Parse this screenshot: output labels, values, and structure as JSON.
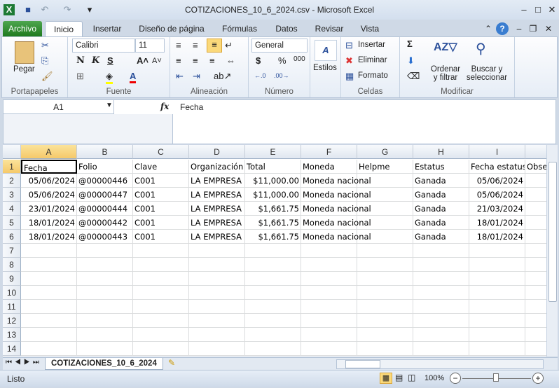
{
  "window": {
    "title": "COTIZACIONES_10_6_2024.csv - Microsoft Excel"
  },
  "tabs": [
    "Archivo",
    "Inicio",
    "Insertar",
    "Diseño de página",
    "Fórmulas",
    "Datos",
    "Revisar",
    "Vista"
  ],
  "ribbon": {
    "clipboard": {
      "label": "Portapapeles",
      "paste": "Pegar"
    },
    "font": {
      "label": "Fuente",
      "name": "Calibri",
      "size": "11",
      "bold": "N",
      "italic": "K",
      "underline": "S"
    },
    "alignment": {
      "label": "Alineación"
    },
    "number": {
      "label": "Número",
      "format": "General",
      "currency": "$",
      "percent": "%",
      "thousands": "000"
    },
    "styles": {
      "label": "Estilos"
    },
    "cells": {
      "label": "Celdas",
      "insert": "Insertar",
      "delete": "Eliminar",
      "format": "Formato"
    },
    "editing": {
      "label": "Modificar",
      "sort": "Ordenar",
      "sort2": "y filtrar",
      "find": "Buscar y",
      "find2": "seleccionar",
      "sum": "Σ"
    }
  },
  "formula_bar": {
    "name_box": "A1",
    "fx": "fx",
    "content": "Fecha"
  },
  "grid": {
    "columns": [
      "A",
      "B",
      "C",
      "D",
      "E",
      "F",
      "G",
      "H",
      "I",
      ""
    ],
    "row_numbers": [
      "1",
      "2",
      "3",
      "4",
      "5",
      "6",
      "7",
      "8",
      "9",
      "10",
      "11",
      "12",
      "13",
      "14"
    ],
    "rows": [
      [
        "Fecha",
        "Folio",
        "Clave",
        "Organización",
        "Total",
        "Moneda",
        "Helpme",
        "Estatus",
        "Fecha estatus",
        "Observaciones"
      ],
      [
        "05/06/2024",
        "@00000446",
        "C001",
        "LA EMPRESA",
        "$11,000.00",
        "Moneda nacional",
        "",
        "Ganada",
        "05/06/2024",
        ""
      ],
      [
        "05/06/2024",
        "@00000447",
        "C001",
        "LA EMPRESA",
        "$11,000.00",
        "Moneda nacional",
        "",
        "Ganada",
        "05/06/2024",
        ""
      ],
      [
        "23/01/2024",
        "@00000444",
        "C001",
        "LA EMPRESA",
        "$1,661.75",
        "Moneda nacional",
        "",
        "Ganada",
        "21/03/2024",
        ""
      ],
      [
        "18/01/2024",
        "@00000442",
        "C001",
        "LA EMPRESA",
        "$1,661.75",
        "Moneda nacional",
        "",
        "Ganada",
        "18/01/2024",
        ""
      ],
      [
        "18/01/2024",
        "@00000443",
        "C001",
        "LA EMPRESA",
        "$1,661.75",
        "Moneda nacional",
        "",
        "Ganada",
        "18/01/2024",
        ""
      ]
    ]
  },
  "sheet_tab": "COTIZACIONES_10_6_2024",
  "status": {
    "text": "Listo",
    "zoom": "100%"
  }
}
